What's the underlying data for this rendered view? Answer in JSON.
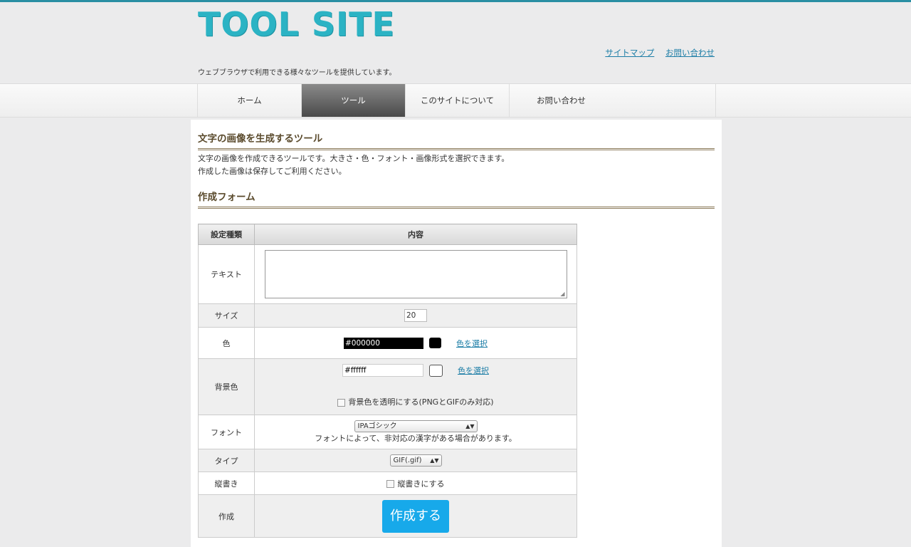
{
  "header": {
    "logo": "TOOL SITE",
    "tagline": "ウェブブラウザで利用できる様々なツールを提供しています。",
    "links": [
      "サイトマップ",
      "お問い合わせ"
    ]
  },
  "nav": {
    "items": [
      "ホーム",
      "ツール",
      "このサイトについて",
      "お問い合わせ"
    ],
    "active": "ツール"
  },
  "main": {
    "title": "文字の画像を生成するツール",
    "desc_line1": "文字の画像を作成できるツールです。大きさ・色・フォント・画像形式を選択できます。",
    "desc_line2": "作成した画像は保存してご利用ください。",
    "form_title": "作成フォーム"
  },
  "form": {
    "col_setting": "設定種類",
    "col_content": "内容",
    "text_label": "テキスト",
    "text_value": "",
    "size_label": "サイズ",
    "size_value": "20",
    "color_label": "色",
    "color_value": "#000000",
    "color_pick": "色を選択",
    "bg_label": "背景色",
    "bg_value": "#ffffff",
    "bg_pick": "色を選択",
    "transparent_label": "背景色を透明にする(PNGとGIFのみ対応)",
    "font_label": "フォント",
    "font_value": "IPAゴシック",
    "font_note": "フォントによって、非対応の漢字がある場合があります。",
    "type_label": "タイプ",
    "type_value": "GIF(.gif)",
    "vertical_label": "縦書き",
    "vertical_check": "縦書きにする",
    "create_label": "作成",
    "create_button": "作成する"
  },
  "colors": {
    "accent": "#2bb3c4",
    "button": "#17a9ea",
    "link": "#1b7da6"
  }
}
